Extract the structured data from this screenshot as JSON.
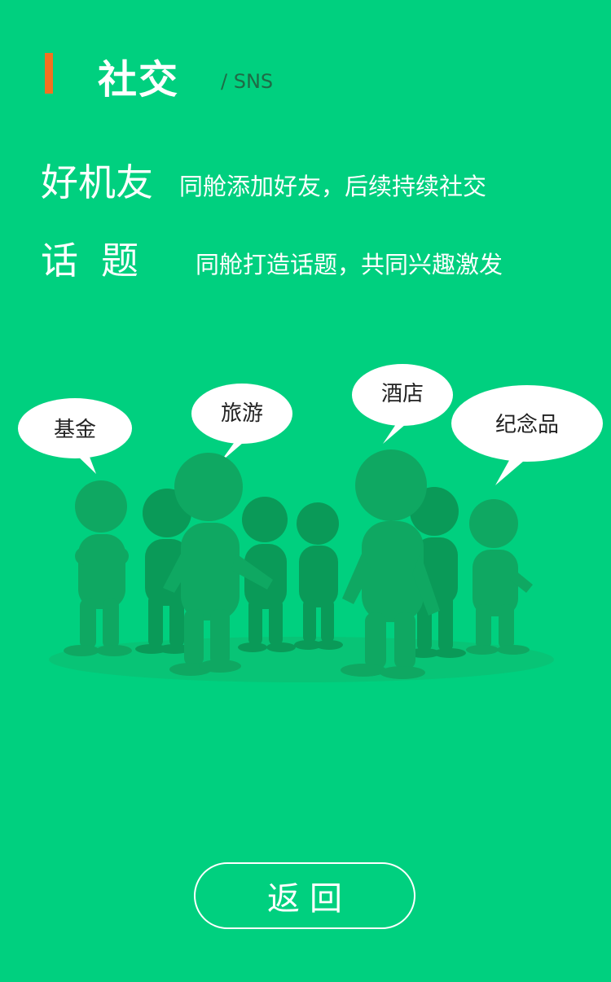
{
  "header": {
    "title": "社交",
    "subtitle": "/ SNS",
    "accent_color": "#f27120"
  },
  "features": [
    {
      "name": "好机友",
      "description": "同舱添加好友，后续持续社交"
    },
    {
      "name": "话题",
      "description": "同舱打造话题，共同兴趣激发"
    }
  ],
  "bubbles": [
    "基金",
    "旅游",
    "酒店",
    "纪念品"
  ],
  "back_button": {
    "label": "返回"
  },
  "colors": {
    "background": "#00d07f",
    "figure": "#0fa862",
    "figure_shadow": "#0a8a4e",
    "bubble": "#ffffff"
  }
}
